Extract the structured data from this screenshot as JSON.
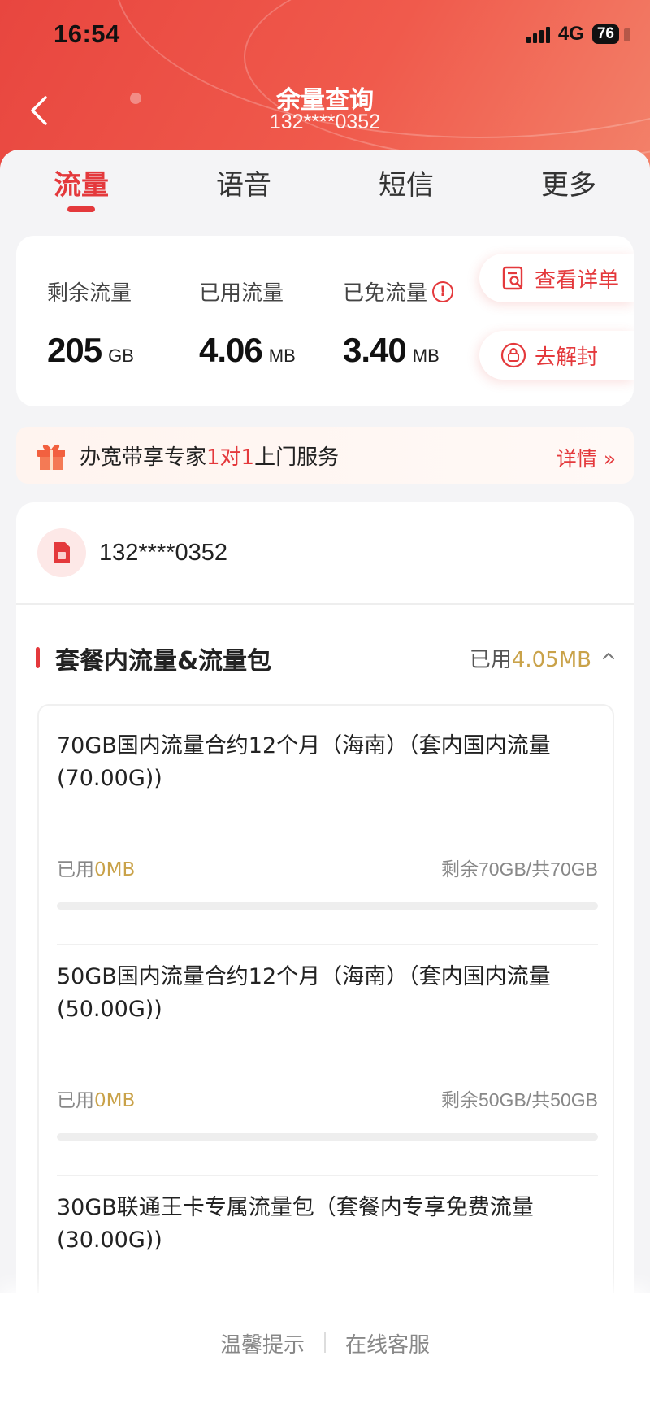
{
  "status_bar": {
    "time": "16:54",
    "network": "4G",
    "battery": "76"
  },
  "nav": {
    "title": "余量查询",
    "subtitle": "132****0352"
  },
  "tabs": [
    {
      "label": "流量",
      "active": true
    },
    {
      "label": "语音",
      "active": false
    },
    {
      "label": "短信",
      "active": false
    },
    {
      "label": "更多",
      "active": false
    }
  ],
  "stats": {
    "remaining": {
      "label": "剩余流量",
      "value": "205",
      "unit": "GB"
    },
    "used": {
      "label": "已用流量",
      "value": "4.06",
      "unit": "MB"
    },
    "free": {
      "label": "已免流量",
      "value": "3.40",
      "unit": "MB",
      "info_icon": "!"
    }
  },
  "actions": {
    "details": "查看详单",
    "unlock": "去解封"
  },
  "banner": {
    "text_before": "办宽带享专家",
    "text_highlight": "1对1",
    "text_after": "上门服务",
    "more": "详情 »"
  },
  "account": {
    "number": "132****0352"
  },
  "section": {
    "title": "套餐内流量&流量包",
    "used_prefix": "已用",
    "used_value": "4.05MB"
  },
  "packages": [
    {
      "name": "70GB国内流量合约12个月（海南）（套内国内流量(70.00G))",
      "used_prefix": "已用",
      "used_value": "0MB",
      "remaining": "剩余70GB/共70GB",
      "used_fraction": 0
    },
    {
      "name": "50GB国内流量合约12个月（海南）（套内国内流量(50.00G))",
      "used_prefix": "已用",
      "used_value": "0MB",
      "remaining": "剩余50GB/共50GB",
      "used_fraction": 0
    },
    {
      "name": "30GB联通王卡专属流量包（套餐内专享免费流量(30.00G))"
    }
  ],
  "footer": {
    "tips": "温馨提示",
    "service": "在线客服"
  },
  "colors": {
    "brand_red": "#e4393c",
    "gold": "#c9a249"
  },
  "icons": {
    "back": "chevron-left-icon",
    "details": "receipt-search-icon",
    "unlock": "lock-icon",
    "gift": "gift-icon",
    "sim": "sim-card-icon",
    "collapse": "chevron-up-icon"
  }
}
